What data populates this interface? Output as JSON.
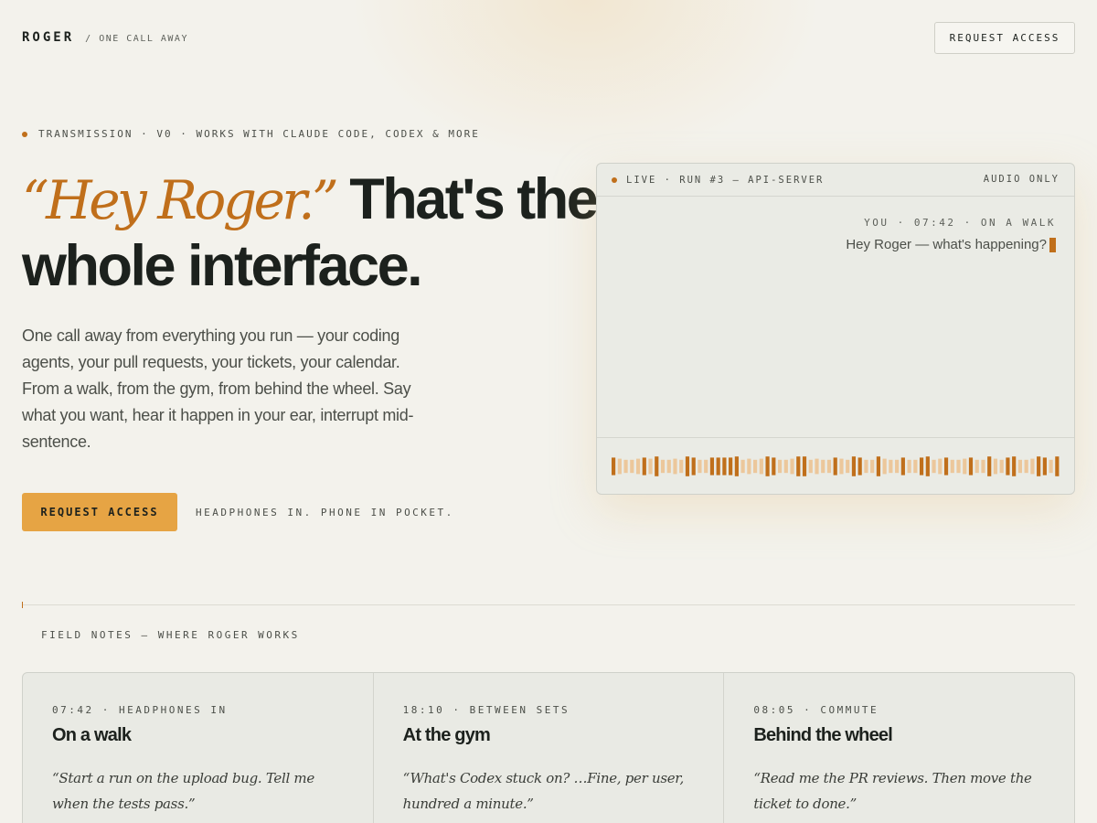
{
  "header": {
    "brand": "ROGER",
    "tagline": "/ ONE CALL AWAY",
    "cta_label": "REQUEST ACCESS"
  },
  "hero": {
    "eyebrow": "TRANSMISSION · V0 · WORKS WITH CLAUDE CODE, CODEX & MORE",
    "headline_quote": "“Hey Roger.”",
    "headline_rest_1": "That's the",
    "headline_rest_2": "whole interface.",
    "lede": "One call away from everything you run — your coding agents, your pull requests, your tickets, your calendar. From a walk, from the gym, from behind the wheel. Say what you want, hear it happen in your ear, interrupt mid-sentence.",
    "cta_label": "REQUEST ACCESS",
    "cta_note": "HEADPHONES IN. PHONE IN POCKET."
  },
  "live_panel": {
    "status": "LIVE · RUN #3 — API-SERVER",
    "mode": "AUDIO ONLY",
    "message_meta": "YOU · 07:42 · ON A WALK",
    "message_text": "Hey Roger — what's happening?",
    "waveform_levels": [
      0.8,
      0.7,
      0.6,
      0.6,
      0.7,
      0.8,
      0.7,
      0.9,
      0.6,
      0.6,
      0.7,
      0.6,
      0.9,
      0.8,
      0.6,
      0.6,
      0.8,
      0.8,
      0.8,
      0.8,
      0.9,
      0.6,
      0.7,
      0.6,
      0.7,
      0.9,
      0.8,
      0.6,
      0.6,
      0.7,
      0.9,
      0.9,
      0.6,
      0.7,
      0.6,
      0.6,
      0.8,
      0.7,
      0.6,
      0.9,
      0.8,
      0.6,
      0.6,
      0.9,
      0.7,
      0.6,
      0.6,
      0.8,
      0.6,
      0.6,
      0.8,
      0.9,
      0.6,
      0.7,
      0.8,
      0.6,
      0.6,
      0.7,
      0.8,
      0.6,
      0.6,
      0.9,
      0.7,
      0.6,
      0.8,
      0.9,
      0.6,
      0.6,
      0.7,
      0.9,
      0.8,
      0.6,
      0.9
    ],
    "colors": {
      "accent": "#c06f1b",
      "accent_light": "#ecc79b"
    }
  },
  "field_notes": {
    "section_label": "FIELD NOTES — WHERE ROGER WORKS",
    "cards": [
      {
        "meta": "07:42 · HEADPHONES IN",
        "title": "On a walk",
        "quote": "“Start a run on the upload bug. Tell me when the tests pass.”"
      },
      {
        "meta": "18:10 · BETWEEN SETS",
        "title": "At the gym",
        "quote": "“What's Codex stuck on? …Fine, per user, hundred a minute.”"
      },
      {
        "meta": "08:05 · COMMUTE",
        "title": "Behind the wheel",
        "quote": "“Read me the PR reviews. Then move the ticket to done.”"
      }
    ]
  }
}
